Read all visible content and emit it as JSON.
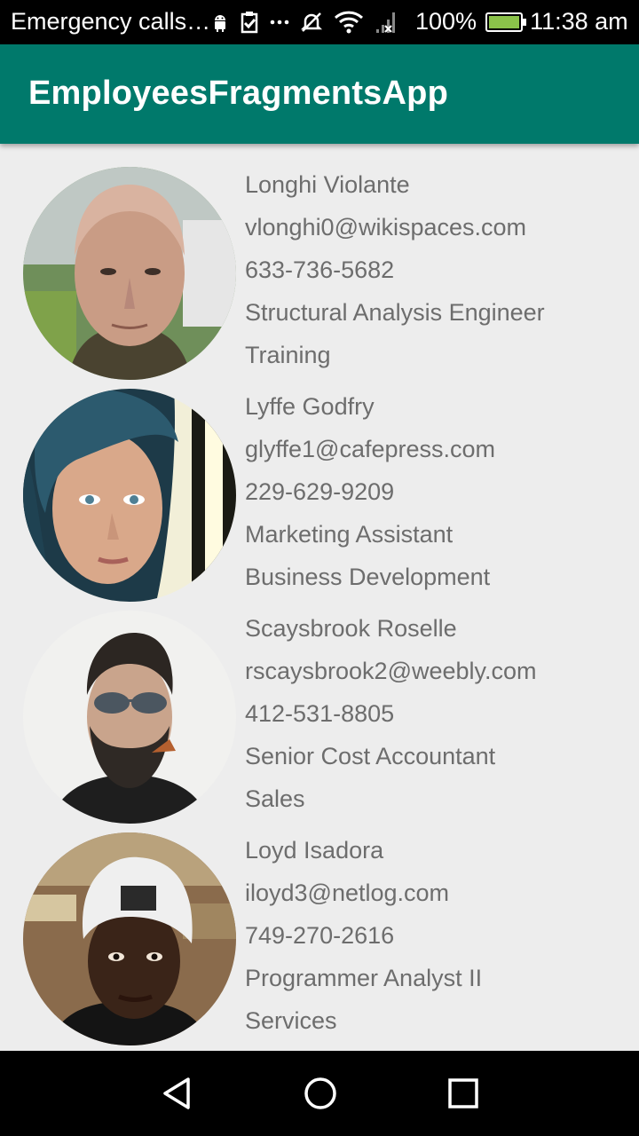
{
  "status_bar": {
    "notification_text": "Emergency calls…",
    "battery_percent": "100%",
    "time": "11:38 am",
    "icons": [
      "android-icon",
      "clipboard-check-icon",
      "more-dots-icon",
      "mute-icon",
      "wifi-icon",
      "no-signal-icon",
      "battery-charging-icon"
    ],
    "battery_color": "#8bc34a"
  },
  "app_bar": {
    "title": "EmployeesFragmentsApp",
    "color": "#00796b"
  },
  "employees": [
    {
      "name": "Longhi Violante",
      "email": "vlonghi0@wikispaces.com",
      "phone": "633-736-5682",
      "title": "Structural Analysis Engineer",
      "department": "Training"
    },
    {
      "name": "Lyffe Godfry",
      "email": "glyffe1@cafepress.com",
      "phone": "229-629-9209",
      "title": "Marketing Assistant",
      "department": "Business Development"
    },
    {
      "name": "Scaysbrook Roselle",
      "email": "rscaysbrook2@weebly.com",
      "phone": "412-531-8805",
      "title": "Senior Cost Accountant",
      "department": "Sales"
    },
    {
      "name": "Loyd Isadora",
      "email": "iloyd3@netlog.com",
      "phone": "749-270-2616",
      "title": "Programmer Analyst II",
      "department": "Services"
    }
  ],
  "nav_bar": {
    "buttons": [
      "back-icon",
      "home-icon",
      "recents-icon"
    ]
  }
}
